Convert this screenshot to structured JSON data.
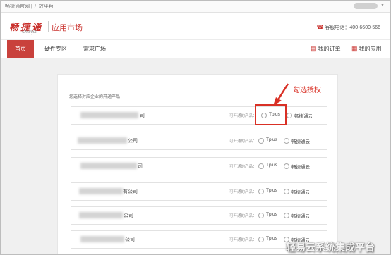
{
  "topbar": {
    "text": "畅捷通官网 | 开放平台"
  },
  "header": {
    "logo_text": "畅捷通",
    "logo_sub": "Chanjet",
    "market_title": "应用市场",
    "phone_label": "客服电话：400-6600-566"
  },
  "nav": {
    "tabs": [
      {
        "label": "首页",
        "active": true
      },
      {
        "label": "硬件专区",
        "active": false
      },
      {
        "label": "需求广场",
        "active": false
      }
    ],
    "my_orders": "我的订单",
    "my_apps": "我的应用"
  },
  "main": {
    "instruction": "您选择对应企业的开通产品：",
    "rows": [
      {
        "company_suffix": "司",
        "hint": "可开通的产品：",
        "options": [
          "Tplus",
          "畅捷通云"
        ]
      },
      {
        "company_suffix": "公司",
        "hint": "可开通的产品：",
        "options": [
          "Tplus",
          "畅捷通云"
        ]
      },
      {
        "company_suffix": "司",
        "hint": "可开通的产品：",
        "options": [
          "Tplus",
          "畅捷通云"
        ]
      },
      {
        "company_suffix": "有公司",
        "hint": "可开通的产品：",
        "options": [
          "Tplus",
          "畅捷通云"
        ]
      },
      {
        "company_suffix": "公司",
        "hint": "可开通的产品：",
        "options": [
          "Tplus",
          "畅捷通云"
        ]
      },
      {
        "company_suffix": "公司",
        "hint": "可开通的产品：",
        "options": [
          "Tplus",
          "畅捷通云"
        ]
      }
    ]
  },
  "annotation": {
    "label": "勾选授权",
    "color": "#d93025"
  },
  "watermark": "轻易云系统集成平台",
  "colors": {
    "brand_red": "#c9302c",
    "nav_active": "#c9413c"
  }
}
